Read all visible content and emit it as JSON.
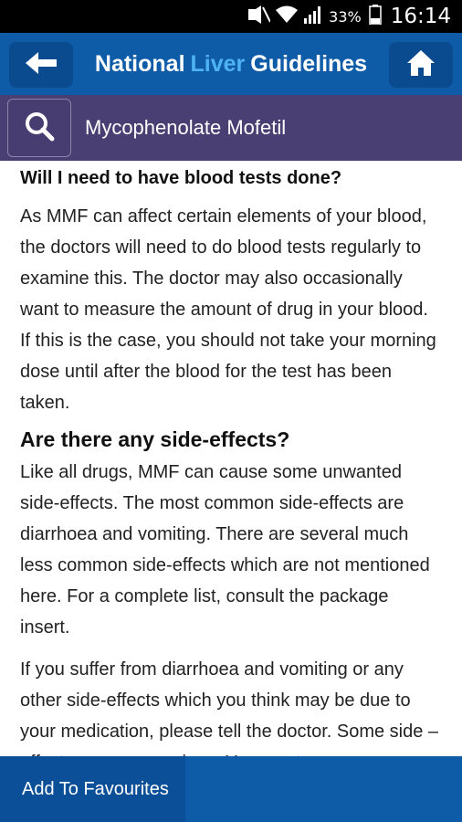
{
  "status_bar": {
    "battery": "33%",
    "time": "16:14",
    "icons": [
      "mute-icon",
      "wifi-icon",
      "signal-icon",
      "battery-icon"
    ]
  },
  "app_bar": {
    "title_part1": "National",
    "title_part2": "Liver",
    "title_part3": "Guidelines",
    "back_icon": "arrow-left-icon",
    "home_icon": "home-icon"
  },
  "search_bar": {
    "title": "Mycophenolate Mofetil",
    "search_icon": "search-icon"
  },
  "content": {
    "heading1": "Will I need to have blood tests done?",
    "para1": "As MMF can affect certain elements of your blood, the doctors will need to do blood tests regularly to examine this. The doctor may also occasionally want to measure the amount of drug in your blood. If this is the case, you should not take your morning dose until after the blood for the test has been taken.",
    "heading2": "Are there any side-effects?",
    "para2": "Like all drugs, MMF can cause some unwanted side-effects. The most common side-effects are diarrhoea and vomiting. There are several much less common side-effects which are not mentioned here. For a complete list, consult the package insert.",
    "para3": "If you suffer from diarrhoea and vomiting or any other side-effects which you think may be due to your medication, please tell the doctor. Some side –effects are more serious. You must"
  },
  "footer": {
    "favourites_label": "Add To Favourites"
  },
  "colors": {
    "app_bar": "#0e5ba8",
    "accent_text": "#4fb3f2",
    "search_bar": "#4a3f73"
  }
}
